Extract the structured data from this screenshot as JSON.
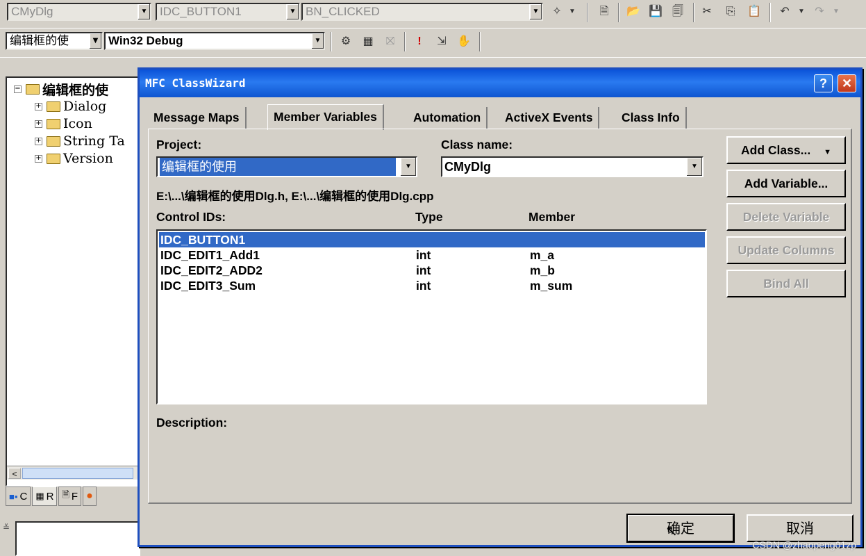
{
  "toolbar1": {
    "class_combo": "CMyDlg",
    "id_combo": "IDC_BUTTON1",
    "msg_combo": "BN_CLICKED"
  },
  "toolbar2": {
    "project_combo": "编辑框的使",
    "config_combo": "Win32 Debug"
  },
  "workspace": {
    "root": "编辑框的使",
    "items": [
      "Dialog",
      "Icon",
      "String Ta",
      "Version"
    ],
    "tabs": [
      "C",
      "R",
      "F"
    ]
  },
  "dialog": {
    "title": "MFC ClassWizard",
    "tabs": [
      "Message Maps",
      "Member Variables",
      "Automation",
      "ActiveX Events",
      "Class Info"
    ],
    "project_label": "Project:",
    "project_value": "编辑框的使用",
    "classname_label": "Class name:",
    "classname_value": "CMyDlg",
    "files": "E:\\...\\编辑框的使用Dlg.h, E:\\...\\编辑框的使用Dlg.cpp",
    "columns": {
      "ids": "Control IDs:",
      "type": "Type",
      "member": "Member"
    },
    "rows": [
      {
        "id": "IDC_BUTTON1",
        "type": "",
        "member": ""
      },
      {
        "id": "IDC_EDIT1_Add1",
        "type": "int",
        "member": "m_a"
      },
      {
        "id": "IDC_EDIT2_ADD2",
        "type": "int",
        "member": "m_b"
      },
      {
        "id": "IDC_EDIT3_Sum",
        "type": "int",
        "member": "m_sum"
      }
    ],
    "description_label": "Description:",
    "buttons": {
      "add_class": "Add Class...",
      "add_variable": "Add Variable...",
      "delete_variable": "Delete Variable",
      "update_columns": "Update Columns",
      "bind_all": "Bind All"
    },
    "ok": "确定",
    "cancel": "取消"
  },
  "watermark": "CSDN @zhaopeng01zp"
}
